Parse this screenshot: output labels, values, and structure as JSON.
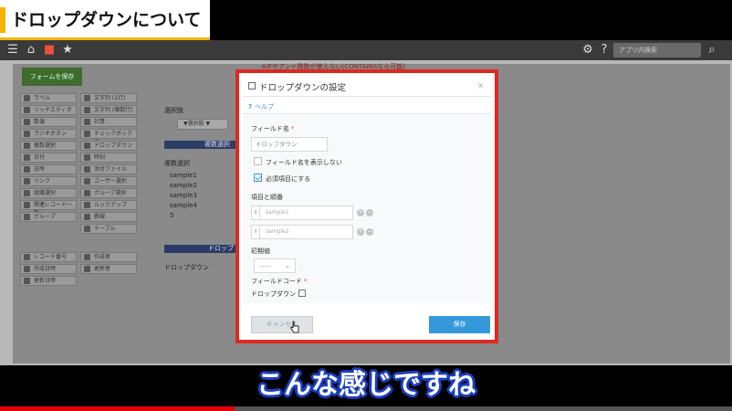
{
  "banner": {
    "title": "ドロップダウンについて"
  },
  "app": {
    "search_placeholder": "アプリ内検索",
    "save_form_label": "フォームを保存",
    "palette": [
      "ラベル",
      "リッチエディター",
      "数値",
      "ラジオボタン",
      "複数選択",
      "日付",
      "日時",
      "リンク",
      "組織選択",
      "関連レコード一覧",
      "グループ",
      "文字列 (1行)",
      "文字列 (複数行)",
      "計算",
      "チェックボックス",
      "ドロップダウン",
      "時刻",
      "添付ファイル",
      "ユーザー選択",
      "グループ選択",
      "ルックアップ",
      "罫線",
      "テーブル"
    ],
    "palette_bottom": [
      "レコード番号",
      "作成日時",
      "更新日時",
      "作成者",
      "更新者"
    ],
    "bg_notice": "※IFやアンド関数が使えない(CONTAINSなら可能)",
    "bg_label_1": "選択肢",
    "bg_select_1": "▼選択肢 ▼",
    "bg_header_1": "複数選択",
    "bg_label_2": "複数選択",
    "bg_samples": [
      "sample1",
      "sample2",
      "sample3",
      "sample4",
      "5"
    ],
    "bg_header_2": "ドロップ",
    "bg_label_3": "ドロップダウン"
  },
  "dialog": {
    "title": "ドロップダウンの設定",
    "close": "×",
    "help": "ヘルプ",
    "field_name_label": "フィールド名",
    "field_name_value": "ドロップダウン",
    "hide_name_label": "フィールド名を表示しない",
    "required_label": "必須項目にする",
    "required_checked": true,
    "options_label": "項目と順番",
    "options": [
      "sample1",
      "sample2"
    ],
    "default_label": "初期値",
    "default_value": "-----",
    "field_code_label": "フィールドコード",
    "field_code_value": "ドロップダウン",
    "cancel_label": "キャンセル",
    "save_label": "保存"
  },
  "subtitle": "こんな感じですね",
  "video_progress": 0.32,
  "colors": {
    "accent_red": "#e0281e",
    "save_blue": "#3498db",
    "subtitle_outline": "#1b3fbf"
  }
}
